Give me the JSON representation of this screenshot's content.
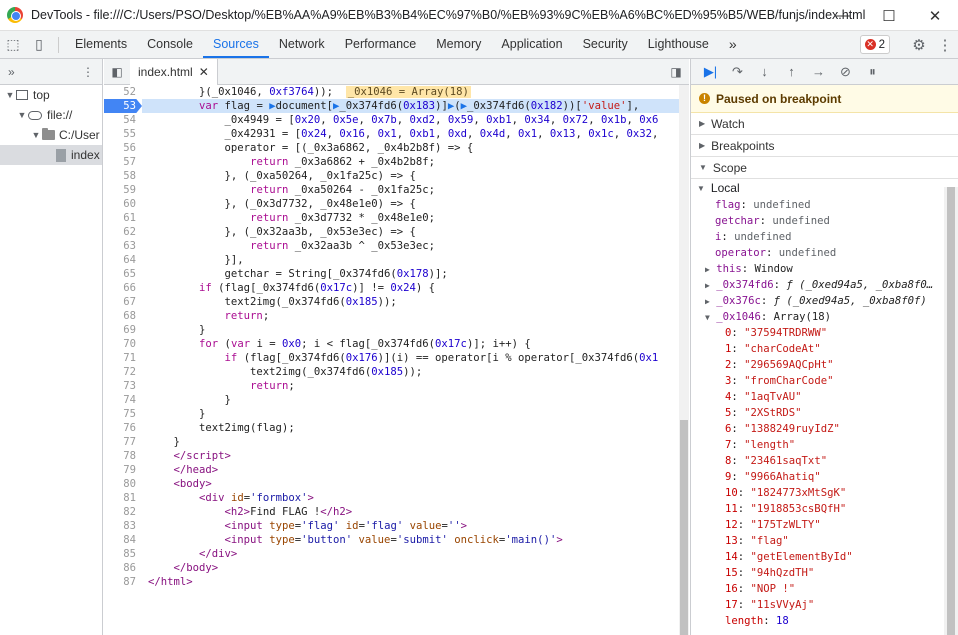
{
  "window": {
    "title": "DevTools - file:///C:/Users/PSO/Desktop/%EB%AA%A9%EB%B3%B4%EC%97%B0/%EB%93%9C%EB%A6%BC%ED%95%B5/WEB/funjs/index.html",
    "min": "—",
    "max": "☐",
    "close": "✕"
  },
  "devtools_tabs": [
    "Elements",
    "Console",
    "Sources",
    "Network",
    "Performance",
    "Memory",
    "Application",
    "Security",
    "Lighthouse"
  ],
  "active_tab": "Sources",
  "more_tabs": "»",
  "error_count": "2",
  "navigator": {
    "more": "»",
    "menu": "⋮",
    "items": [
      {
        "label": "top"
      },
      {
        "label": "file://"
      },
      {
        "label": "C:/User"
      },
      {
        "label": "index"
      }
    ]
  },
  "editor": {
    "file_tab": "index.html",
    "close": "✕"
  },
  "code_lines": [
    {
      "n": "52",
      "html": "        }(_0x1046, <span class='num'>0xf3764</span>));  <span class='inl'>_0x1046 = Array(18)</span>"
    },
    {
      "n": "53",
      "html": "        <span class='kw'>var</span> flag = <span style='color:#1a73e8'>▶</span>document[<span style='color:#1a73e8'>▶</span>_0x374fd6(<span class='num'>0x183</span>)]<span style='color:#1a73e8'>▶</span>(<span style='color:#1a73e8'>▶</span>_0x374fd6(<span class='num'>0x182</span>))[<span class='str'>'value'</span>],"
    },
    {
      "n": "54",
      "html": "            _0x4949 = [<span class='num'>0x20</span>, <span class='num'>0x5e</span>, <span class='num'>0x7b</span>, <span class='num'>0xd2</span>, <span class='num'>0x59</span>, <span class='num'>0xb1</span>, <span class='num'>0x34</span>, <span class='num'>0x72</span>, <span class='num'>0x1b</span>, <span class='num'>0x6</span>"
    },
    {
      "n": "55",
      "html": "            _0x42931 = [<span class='num'>0x24</span>, <span class='num'>0x16</span>, <span class='num'>0x1</span>, <span class='num'>0xb1</span>, <span class='num'>0xd</span>, <span class='num'>0x4d</span>, <span class='num'>0x1</span>, <span class='num'>0x13</span>, <span class='num'>0x1c</span>, <span class='num'>0x32</span>,"
    },
    {
      "n": "56",
      "html": "            operator = [(_0x3a6862, _0x4b2b8f) =&gt; {"
    },
    {
      "n": "57",
      "html": "                <span class='kw'>return</span> _0x3a6862 + _0x4b2b8f;"
    },
    {
      "n": "58",
      "html": "            }, (_0xa50264, _0x1fa25c) =&gt; {"
    },
    {
      "n": "59",
      "html": "                <span class='kw'>return</span> _0xa50264 - _0x1fa25c;"
    },
    {
      "n": "60",
      "html": "            }, (_0x3d7732, _0x48e1e0) =&gt; {"
    },
    {
      "n": "61",
      "html": "                <span class='kw'>return</span> _0x3d7732 * _0x48e1e0;"
    },
    {
      "n": "62",
      "html": "            }, (_0x32aa3b, _0x53e3ec) =&gt; {"
    },
    {
      "n": "63",
      "html": "                <span class='kw'>return</span> _0x32aa3b ^ _0x53e3ec;"
    },
    {
      "n": "64",
      "html": "            }],"
    },
    {
      "n": "65",
      "html": "            getchar = String[_0x374fd6(<span class='num'>0x178</span>)];"
    },
    {
      "n": "66",
      "html": "        <span class='kw'>if</span> (flag[_0x374fd6(<span class='num'>0x17c</span>)] != <span class='num'>0x24</span>) {"
    },
    {
      "n": "67",
      "html": "            text2img(_0x374fd6(<span class='num'>0x185</span>));"
    },
    {
      "n": "68",
      "html": "            <span class='kw'>return</span>;"
    },
    {
      "n": "69",
      "html": "        }"
    },
    {
      "n": "70",
      "html": "        <span class='kw'>for</span> (<span class='kw'>var</span> i = <span class='num'>0x0</span>; i &lt; flag[_0x374fd6(<span class='num'>0x17c</span>)]; i++) {"
    },
    {
      "n": "71",
      "html": "            <span class='kw'>if</span> (flag[_0x374fd6(<span class='num'>0x176</span>)](i) == operator[i % operator[_0x374fd6(<span class='num'>0x1</span>"
    },
    {
      "n": "72",
      "html": "                text2img(_0x374fd6(<span class='num'>0x185</span>));"
    },
    {
      "n": "73",
      "html": "                <span class='kw'>return</span>;"
    },
    {
      "n": "74",
      "html": "            }"
    },
    {
      "n": "75",
      "html": "        }"
    },
    {
      "n": "76",
      "html": "        text2img(flag);"
    },
    {
      "n": "77",
      "html": "    }"
    },
    {
      "n": "78",
      "html": "    <span class='tag'>&lt;/script&gt;</span>"
    },
    {
      "n": "79",
      "html": "    <span class='tag'>&lt;/head&gt;</span>"
    },
    {
      "n": "80",
      "html": "    <span class='tag'>&lt;body&gt;</span>"
    },
    {
      "n": "81",
      "html": "        <span class='tag'>&lt;div</span> <span class='atn'>id</span>=<span class='atv'>'formbox'</span><span class='tag'>&gt;</span>"
    },
    {
      "n": "82",
      "html": "            <span class='tag'>&lt;h2&gt;</span>Find FLAG !<span class='tag'>&lt;/h2&gt;</span>"
    },
    {
      "n": "83",
      "html": "            <span class='tag'>&lt;input</span> <span class='atn'>type</span>=<span class='atv'>'flag'</span> <span class='atn'>id</span>=<span class='atv'>'flag'</span> <span class='atn'>value</span>=<span class='atv'>''</span><span class='tag'>&gt;</span>"
    },
    {
      "n": "84",
      "html": "            <span class='tag'>&lt;input</span> <span class='atn'>type</span>=<span class='atv'>'button'</span> <span class='atn'>value</span>=<span class='atv'>'submit'</span> <span class='atn'>onclick</span>=<span class='atv'>'main()'</span><span class='tag'>&gt;</span>"
    },
    {
      "n": "85",
      "html": "        <span class='tag'>&lt;/div&gt;</span>"
    },
    {
      "n": "86",
      "html": "    <span class='tag'>&lt;/body&gt;</span>"
    },
    {
      "n": "87",
      "html": "<span class='tag'>&lt;/html&gt;</span>"
    }
  ],
  "current_line": "53",
  "debugger": {
    "paused": "Paused on breakpoint",
    "watch": "Watch",
    "breakpoints": "Breakpoints",
    "scope": "Scope",
    "local": "Local",
    "locals": [
      {
        "k": "flag",
        "v": "undefined"
      },
      {
        "k": "getchar",
        "v": "undefined"
      },
      {
        "k": "i",
        "v": "undefined"
      },
      {
        "k": "operator",
        "v": "undefined"
      }
    ],
    "this": "Window",
    "fn1": {
      "k": "_0x374fd6",
      "v": "ƒ (_0xed94a5, _0xba8f0…"
    },
    "fn2": {
      "k": "_0x376c",
      "v": "ƒ (_0xed94a5, _0xba8f0f)"
    },
    "arr": {
      "k": "_0x1046",
      "v": "Array(18)"
    },
    "arr_items": [
      "\"37594TRDRWW\"",
      "\"charCodeAt\"",
      "\"296569AQCpHt\"",
      "\"fromCharCode\"",
      "\"1aqTvAU\"",
      "\"2XStRDS\"",
      "\"1388249ruyIdZ\"",
      "\"length\"",
      "\"23461saqTxt\"",
      "\"9966Ahatiq\"",
      "\"1824773xMtSgK\"",
      "\"1918853csBQfH\"",
      "\"175TzWLTY\"",
      "\"flag\"",
      "\"getElementById\"",
      "\"94hQzdTH\"",
      "\"NOP !\"",
      "\"11sVVyAj\""
    ],
    "length": "18"
  }
}
